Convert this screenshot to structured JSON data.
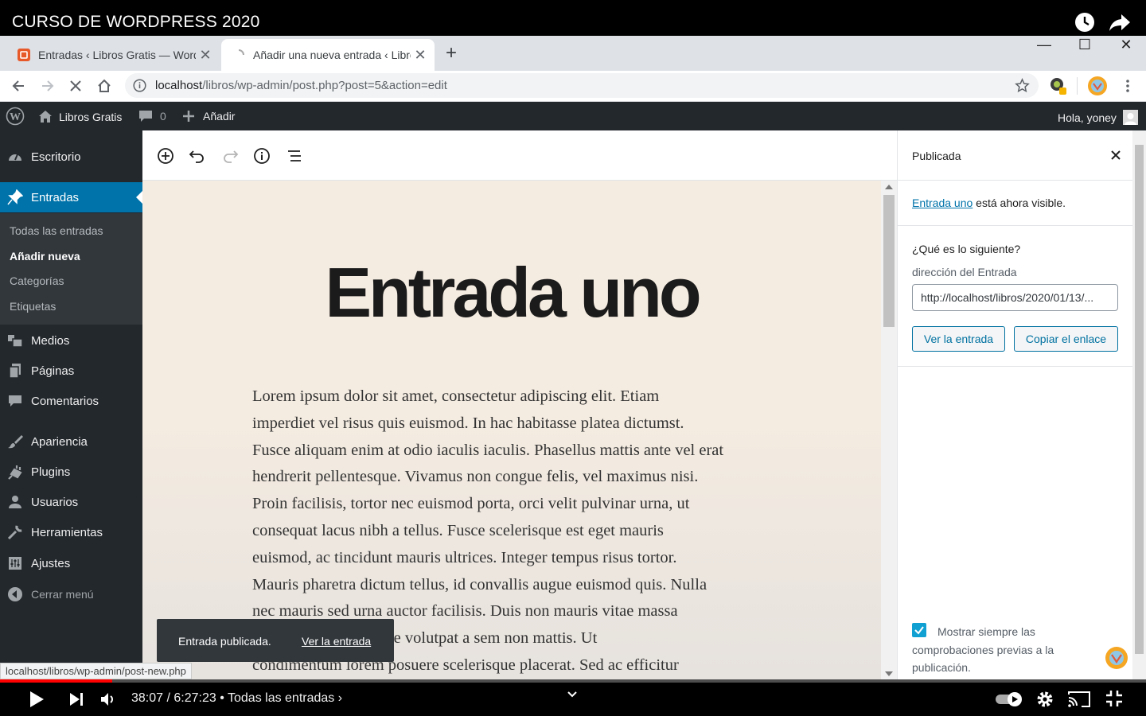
{
  "video": {
    "title": "CURSO DE WORDPRESS 2020",
    "time_current": "38:07",
    "time_sep": " / ",
    "time_total": "6:27:23",
    "chapter": "• Todas las entradas ›",
    "progress_percent": 9.8
  },
  "browser": {
    "tabs": [
      {
        "title": "Entradas ‹ Libros Gratis — WordP",
        "active": false
      },
      {
        "title": "Añadir una nueva entrada ‹ Libro",
        "active": true
      }
    ],
    "url_host": "localhost",
    "url_path": "/libros/wp-admin/post.php?post=5&action=edit",
    "status_url": "localhost/libros/wp-admin/post-new.php"
  },
  "adminbar": {
    "site_name": "Libros Gratis",
    "comments_count": "0",
    "new_label": "Añadir",
    "greeting": "Hola, yoney"
  },
  "sidebar": {
    "items": [
      {
        "label": "Escritorio",
        "icon": "dashboard-icon"
      },
      {
        "label": "Entradas",
        "icon": "pin-icon",
        "current": true
      },
      {
        "label": "Medios",
        "icon": "media-icon"
      },
      {
        "label": "Páginas",
        "icon": "pages-icon"
      },
      {
        "label": "Comentarios",
        "icon": "comments-icon"
      },
      {
        "label": "Apariencia",
        "icon": "brush-icon"
      },
      {
        "label": "Plugins",
        "icon": "plugin-icon"
      },
      {
        "label": "Usuarios",
        "icon": "users-icon"
      },
      {
        "label": "Herramientas",
        "icon": "wrench-icon"
      },
      {
        "label": "Ajustes",
        "icon": "settings-icon"
      },
      {
        "label": "Cerrar menú",
        "icon": "collapse-icon"
      }
    ],
    "submenu": [
      "Todas las entradas",
      "Añadir nueva",
      "Categorías",
      "Etiquetas"
    ]
  },
  "editor": {
    "post_title": "Entrada uno",
    "body_lines": [
      "Lorem ipsum dolor sit amet, consectetur adipiscing elit. Etiam",
      "imperdiet vel risus quis euismod. In hac habitasse platea dictumst.",
      "Fusce aliquam enim at odio iaculis iaculis. Phasellus mattis ante vel erat",
      "hendrerit pellentesque. Vivamus non congue felis, vel maximus nisi.",
      "Proin facilisis, tortor nec euismod porta, orci velit pulvinar urna, ut",
      "consequat lacus nibh a tellus. Fusce scelerisque est eget mauris",
      "euismod, ac tincidunt mauris ultrices. Integer tempus risus tortor.",
      "Mauris pharetra dictum tellus, id convallis augue euismod quis. Nulla",
      "nec mauris sed urna auctor facilisis. Duis non mauris vitae massa",
      "tincidunt. Pellentesque volutpat a sem non mattis. Ut",
      "condimentum lorem posuere scelerisque placerat. Sed ac efficitur"
    ]
  },
  "snackbar": {
    "message": "Entrada publicada.",
    "link": "Ver la entrada"
  },
  "panel": {
    "header": "Publicada",
    "post_link": "Entrada uno",
    "visible_text": " está ahora visible.",
    "next_heading": "¿Qué es lo siguiente?",
    "address_label": "dirección del Entrada",
    "address_value": "http://localhost/libros/2020/01/13/...",
    "view_button": "Ver la entrada",
    "copy_button": "Copiar el enlace",
    "checkbox_label_1": "Mostrar siempre las",
    "checkbox_label_2": "comprobaciones previas a la",
    "checkbox_label_3": "publicación.",
    "checkbox_checked": true
  },
  "colors": {
    "wp_admin_dark": "#23282d",
    "wp_blue": "#0073aa",
    "yt_red": "#ff0000"
  }
}
